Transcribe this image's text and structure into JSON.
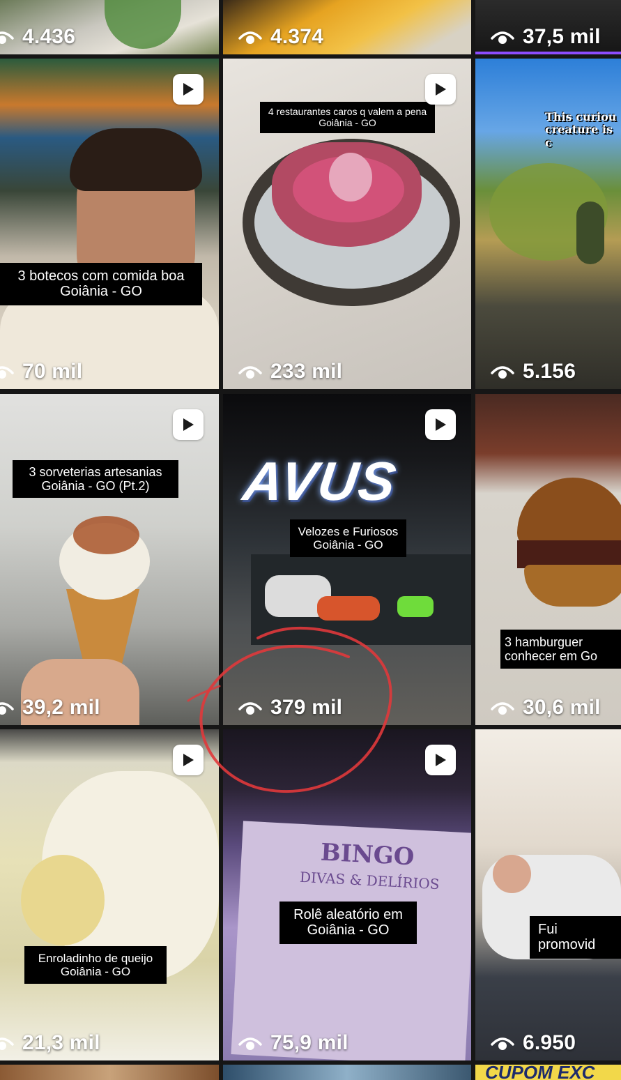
{
  "row0": {
    "t0": {
      "views": "4.436"
    },
    "t1": {
      "views": "4.374"
    },
    "t2": {
      "views": "37,5 mil"
    }
  },
  "row1": {
    "t0": {
      "views": "70 mil",
      "caption": "3 botecos com comida boa\nGoiânia - GO"
    },
    "t1": {
      "views": "233 mil",
      "caption": "4 restaurantes caros q valem a pena\nGoiânia - GO"
    },
    "t2": {
      "views": "5.156",
      "overlay": "This curiou\ncreature is c"
    }
  },
  "row2": {
    "t0": {
      "views": "39,2 mil",
      "caption": "3 sorveterias artesanias\nGoiânia - GO (Pt.2)"
    },
    "t1": {
      "views": "379 mil",
      "caption": "Velozes e Furiosos\nGoiânia - GO",
      "sign": "AVUS"
    },
    "t2": {
      "views": "30,6 mil",
      "caption": "3 hamburguer\nconhecer em Go"
    }
  },
  "row3": {
    "t0": {
      "views": "21,3 mil",
      "caption": "Enroladinho de queijo\nGoiânia - GO"
    },
    "t1": {
      "views": "75,9 mil",
      "caption": "Rolê aleatório em\nGoiânia - GO",
      "card_title": "BINGO",
      "card_sub": "DIVAS & DELÍRIOS"
    },
    "t2": {
      "views": "6.950",
      "caption": "Fui promovid"
    }
  },
  "row4": {
    "t2": {
      "overlay": "CUPOM EXC"
    }
  },
  "colors": {
    "background": "#161616",
    "progress_accent": "#8c4dff",
    "annotation_red": "#e0393b"
  },
  "icons": [
    "eye-icon",
    "play-icon"
  ]
}
